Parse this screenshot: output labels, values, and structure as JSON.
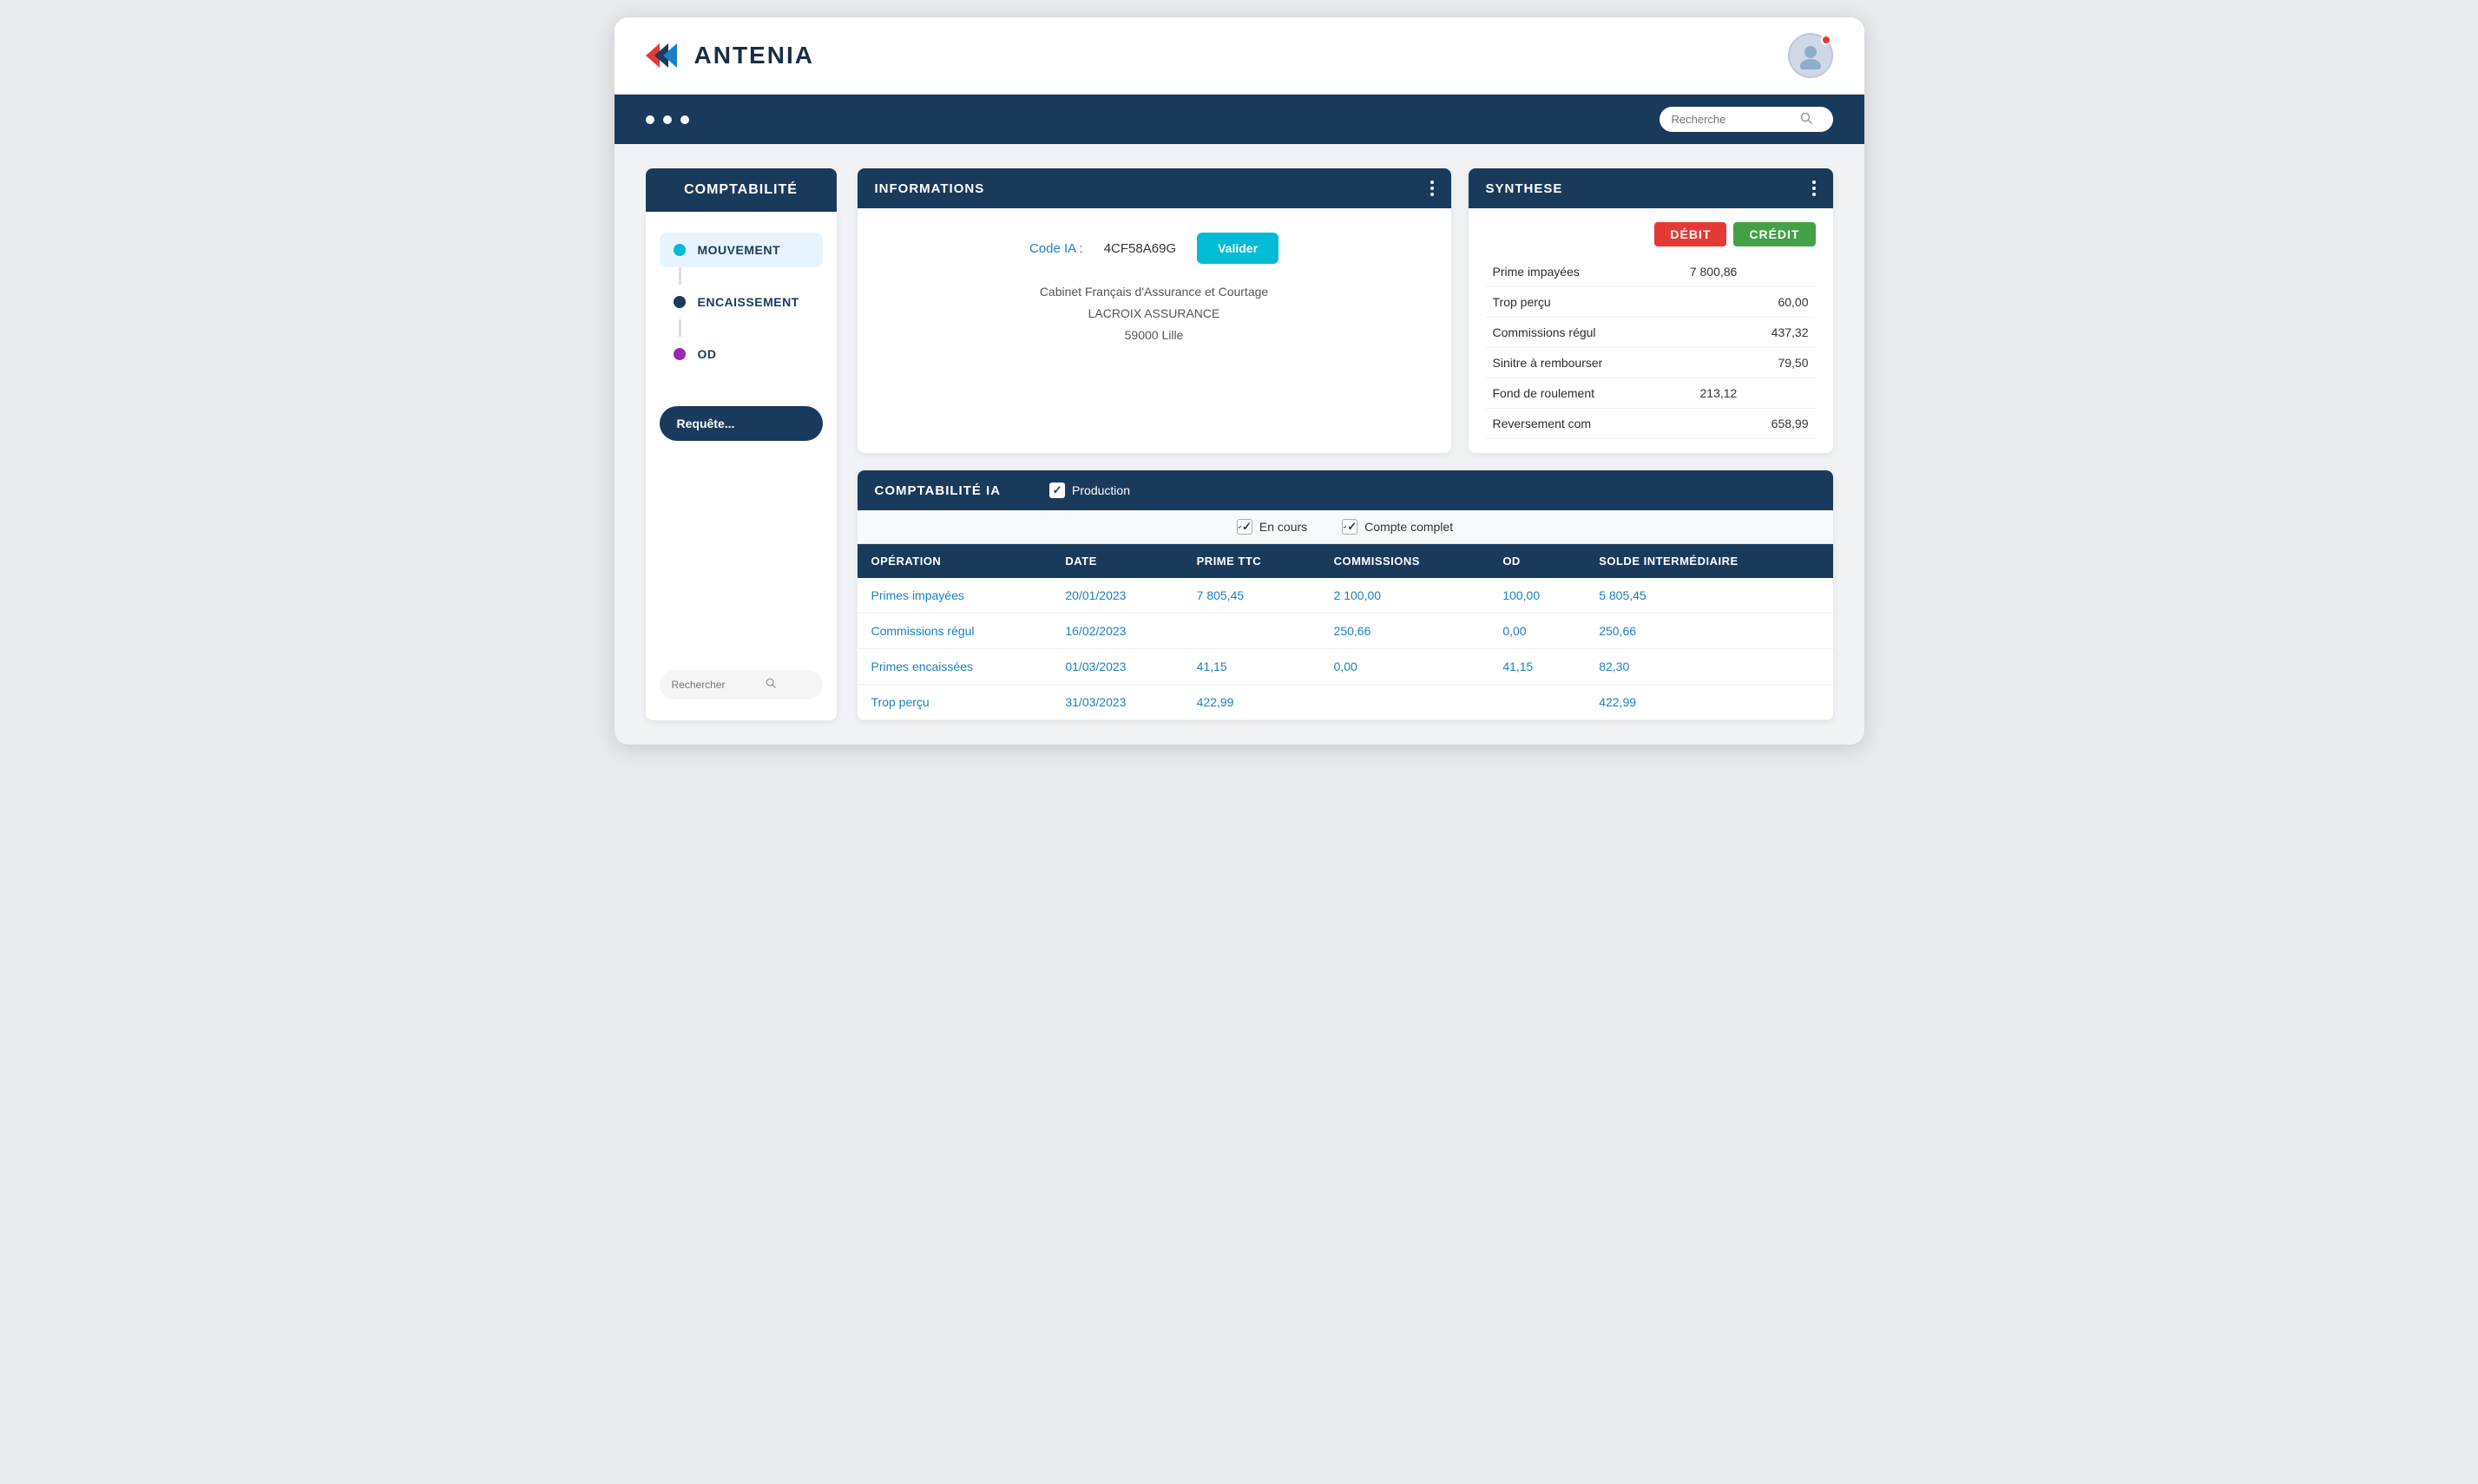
{
  "header": {
    "logo_text": "ANTENIA",
    "search_placeholder": "Recherche"
  },
  "nav": {
    "dots": 3
  },
  "sidebar": {
    "title": "COMPTABILITÉ",
    "items": [
      {
        "label": "MOUVEMENT",
        "color": "#00bcd4",
        "active": true
      },
      {
        "label": "ENCAISSEMENT",
        "color": "#1a3a5c",
        "active": false
      },
      {
        "label": "OD",
        "color": "#9c27b0",
        "active": false
      }
    ],
    "requete_label": "Requête...",
    "search_placeholder": "Rechercher"
  },
  "info_panel": {
    "title": "INFORMATIONS",
    "code_label": "Code IA :",
    "code_value": "4CF58A69G",
    "valider_label": "Valider",
    "address_line1": "Cabinet Français d'Assurance et Courtage",
    "address_line2": "LACROIX ASSURANCE",
    "address_line3": "59000 Lille"
  },
  "synthese_panel": {
    "title": "SYNTHESE",
    "debit_label": "DÉBIT",
    "credit_label": "CRÉDIT",
    "rows": [
      {
        "label": "Prime impayées",
        "debit": "7 800,86",
        "credit": ""
      },
      {
        "label": "Trop perçu",
        "debit": "",
        "credit": "60,00"
      },
      {
        "label": "Commissions régul",
        "debit": "",
        "credit": "437,32"
      },
      {
        "label": "Sinitre à rembourser",
        "debit": "",
        "credit": "79,50"
      },
      {
        "label": "Fond de roulement",
        "debit": "213,12",
        "credit": ""
      },
      {
        "label": "Reversement com",
        "debit": "",
        "credit": "658,99"
      }
    ]
  },
  "bottom_panel": {
    "title": "COMPTABILITÉ IA",
    "checkbox_production_label": "Production",
    "checkbox_en_cours_label": "En cours",
    "checkbox_compte_complet_label": "Compte complet",
    "columns": [
      "OPÉRATION",
      "DATE",
      "PRIME TTC",
      "COMMISSIONS",
      "OD",
      "SOLDE INTERMÉDIAIRE"
    ],
    "rows": [
      {
        "operation": "Primes impayées",
        "date": "20/01/2023",
        "prime_ttc": "7 805,45",
        "commissions": "2 100,00",
        "od": "100,00",
        "solde": "5 805,45"
      },
      {
        "operation": "Commissions régul",
        "date": "16/02/2023",
        "prime_ttc": "",
        "commissions": "250,66",
        "od": "0,00",
        "solde": "250,66"
      },
      {
        "operation": "Primes encaissées",
        "date": "01/03/2023",
        "prime_ttc": "41,15",
        "commissions": "0,00",
        "od": "41,15",
        "solde": "82,30"
      },
      {
        "operation": "Trop perçu",
        "date": "31/03/2023",
        "prime_ttc": "422,99",
        "commissions": "",
        "od": "",
        "solde": "422,99"
      }
    ]
  }
}
